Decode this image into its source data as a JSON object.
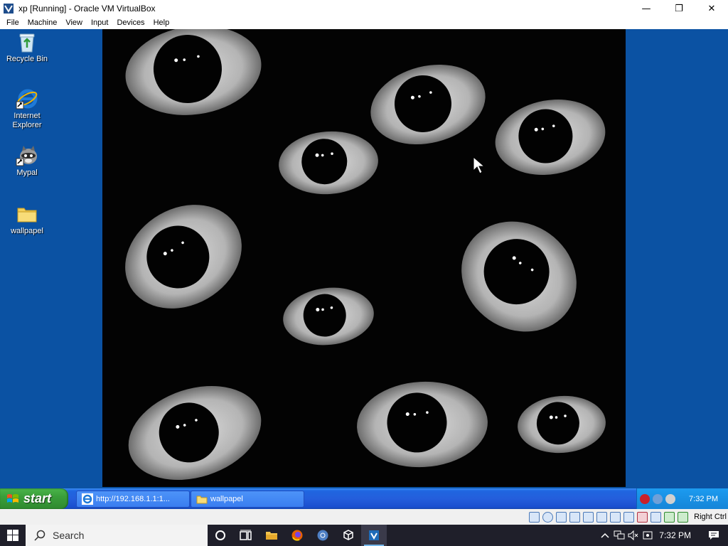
{
  "window": {
    "title": "xp [Running] - Oracle VM VirtualBox",
    "minimize_glyph": "—",
    "restore_glyph": "❐",
    "close_glyph": "✕"
  },
  "menu": [
    "File",
    "Machine",
    "View",
    "Input",
    "Devices",
    "Help"
  ],
  "desktop_icons": [
    {
      "label": "Recycle Bin",
      "icon": "recycle-bin-icon"
    },
    {
      "label": "Internet Explorer",
      "icon": "internet-explorer-icon"
    },
    {
      "label": "Mypal",
      "icon": "mypal-icon"
    },
    {
      "label": "wallpapel",
      "icon": "folder-icon"
    }
  ],
  "xp_taskbar": {
    "start_label": "start",
    "items": [
      {
        "label": "http://192.168.1.1:1...",
        "icon": "internet-explorer-icon"
      },
      {
        "label": "wallpapel",
        "icon": "folder-icon"
      }
    ],
    "clock": "7:32 PM"
  },
  "vbox_status": {
    "host_key": "Right Ctrl"
  },
  "host_taskbar": {
    "search_label": "Search",
    "clock": "7:32 PM"
  },
  "colors": {
    "xp_desktop": "#0b52a3",
    "xp_taskbar": "#245edc",
    "start_green": "#3a9e3a",
    "host_taskbar": "#1f1f2a"
  }
}
